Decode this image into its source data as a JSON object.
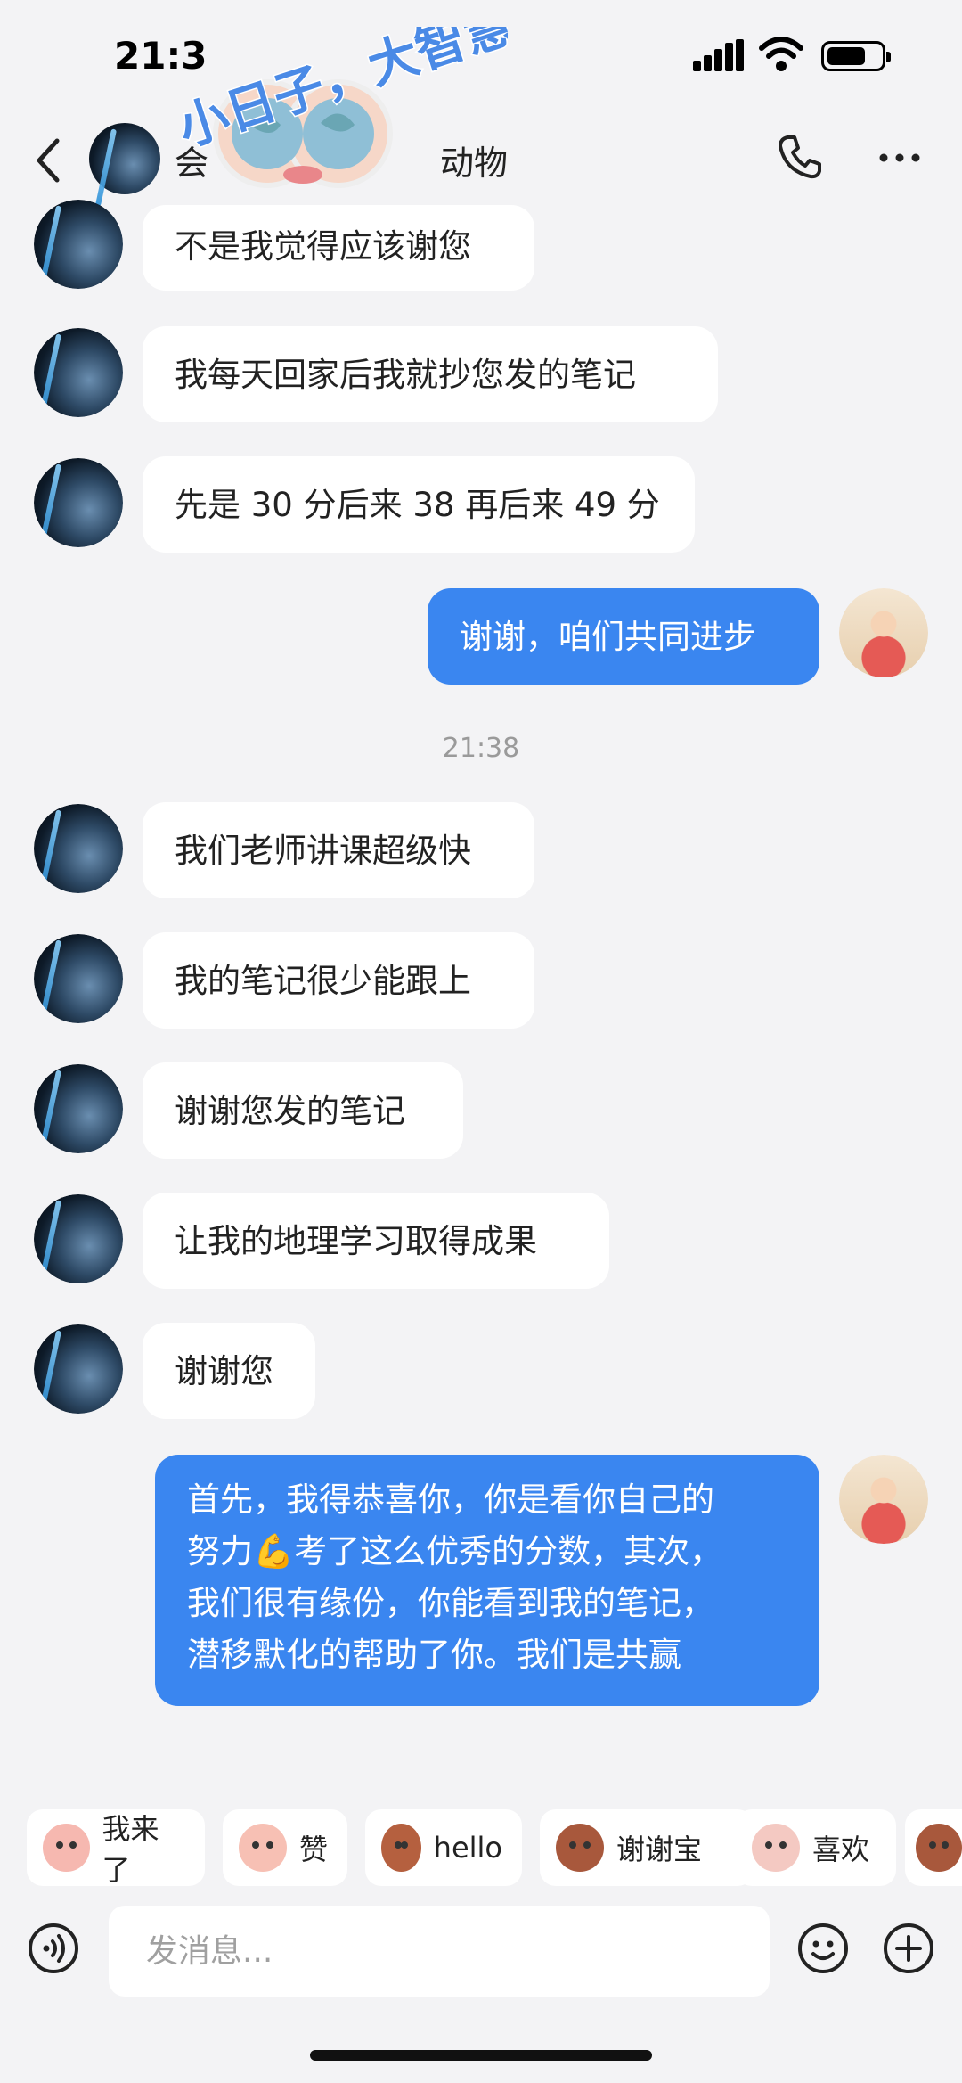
{
  "status_bar": {
    "time": "21:3"
  },
  "header": {
    "title": "会",
    "title_tail": "动物",
    "sticker_text": "小日子，大智慧"
  },
  "messages": [
    {
      "side": "in",
      "text": "不是我觉得应该谢您"
    },
    {
      "side": "in",
      "text": "我每天回家后我就抄您发的笔记"
    },
    {
      "side": "in",
      "text": "先是 30 分后来 38 再后来 49 分"
    },
    {
      "side": "out",
      "text": "谢谢，咱们共同进步"
    },
    {
      "side": "in",
      "text": "我们老师讲课超级快"
    },
    {
      "side": "in",
      "text": "我的笔记很少能跟上"
    },
    {
      "side": "in",
      "text": "谢谢您发的笔记"
    },
    {
      "side": "in",
      "text": "让我的地理学习取得成果"
    },
    {
      "side": "in",
      "text": "谢谢您"
    },
    {
      "side": "out",
      "lines": [
        "首先，我得恭喜你，你是看你自己的",
        "努力💪考了这么优秀的分数，其次，",
        "我们很有缘份，你能看到我的笔记，",
        "潜移默化的帮助了你。我们是共赢"
      ]
    }
  ],
  "timestamp": "21:38",
  "quick_replies": [
    "我来了",
    "赞",
    "hello",
    "谢谢宝",
    "喜欢"
  ],
  "input": {
    "placeholder": "发消息..."
  },
  "colors": {
    "background": "#f3f3f5",
    "outgoing_bubble": "#3a86f0",
    "incoming_bubble": "#ffffff"
  }
}
